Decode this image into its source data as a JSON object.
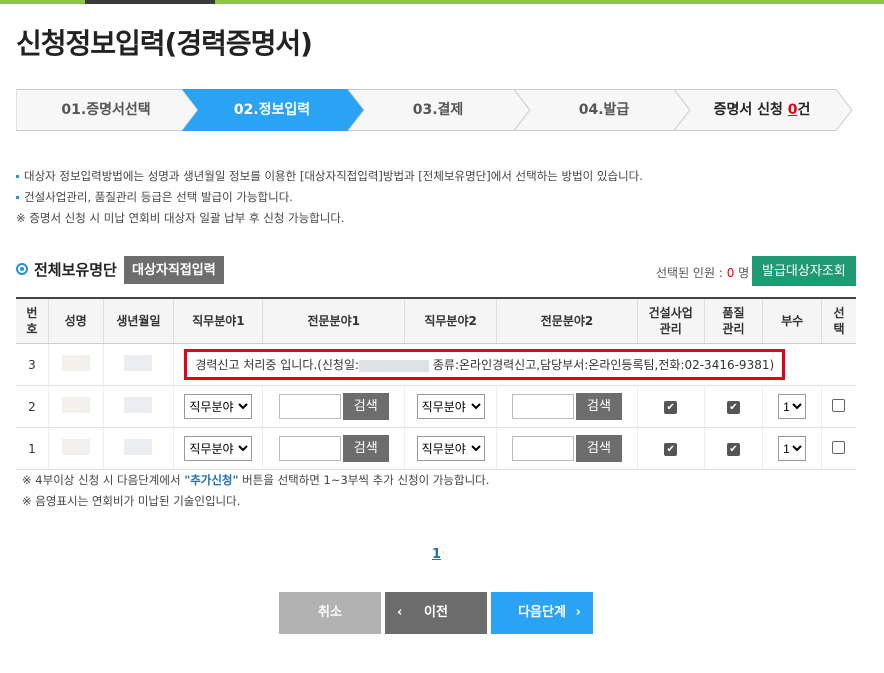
{
  "page_title": "신청정보입력(경력증명서)",
  "steps": [
    {
      "label": "01.증명서선택",
      "active": false
    },
    {
      "label": "02.정보입력",
      "active": true
    },
    {
      "label": "03.결제",
      "active": false
    },
    {
      "label": "04.발급",
      "active": false
    }
  ],
  "summary": {
    "prefix": "증명서 신청 ",
    "count": "0",
    "suffix": "건"
  },
  "notes": [
    "대상자 정보입력방법에는 성명과 생년월일 정보를 이용한 [대상자직접입력]방법과 [전체보유명단]에서 선택하는 방법이 있습니다.",
    "건설사업관리, 품질관리 등급은 선택 발급이 가능합니다.",
    "※ 증명서 신청 시 미납 연회비 대상자 일괄 납부 후 신청 가능합니다."
  ],
  "section": {
    "title": "전체보유명단",
    "direct_input_button": "대상자직접입력",
    "selected_label": "선택된 인원 : ",
    "selected_count": "0",
    "selected_unit": " 명",
    "lookup_button": "발급대상자조회"
  },
  "table": {
    "headers": {
      "no": "번호",
      "name": "성명",
      "birth": "생년월일",
      "field1": "직무분야1",
      "spec1": "전문분야1",
      "field2": "직무분야2",
      "spec2": "전문분야2",
      "cm": "건설사업관리",
      "qc": "품질관리",
      "copies": "부수",
      "select": "선택"
    },
    "rows": [
      {
        "no": "3",
        "notice": "경력신고 처리중 입니다.(신청일:",
        "notice_tail": " 종류:온라인경력신고,담당부서:온라인등록팀,전화:02-3416-9381)"
      },
      {
        "no": "2",
        "field1": "직무분야",
        "search": "검색",
        "field2": "직무분야",
        "copies": "1"
      },
      {
        "no": "1",
        "field1": "직무분야",
        "search": "검색",
        "field2": "직무분야",
        "copies": "1"
      }
    ]
  },
  "footnotes": {
    "line1_a": "※ 4부이상 신청 시 다음단계에서 ",
    "line1_hl": "\"추가신청\"",
    "line1_b": " 버튼을 선택하면 1~3부씩 추가 신청이 가능합니다.",
    "line2": "※ 음영표시는 연회비가 미납된 기술인입니다."
  },
  "pagination": {
    "current": "1"
  },
  "buttons": {
    "cancel": "취소",
    "prev": "이전",
    "next": "다음단계"
  },
  "colors": {
    "accent": "#2aa3f5",
    "green": "#1e9b73",
    "alert": "#e60012"
  }
}
